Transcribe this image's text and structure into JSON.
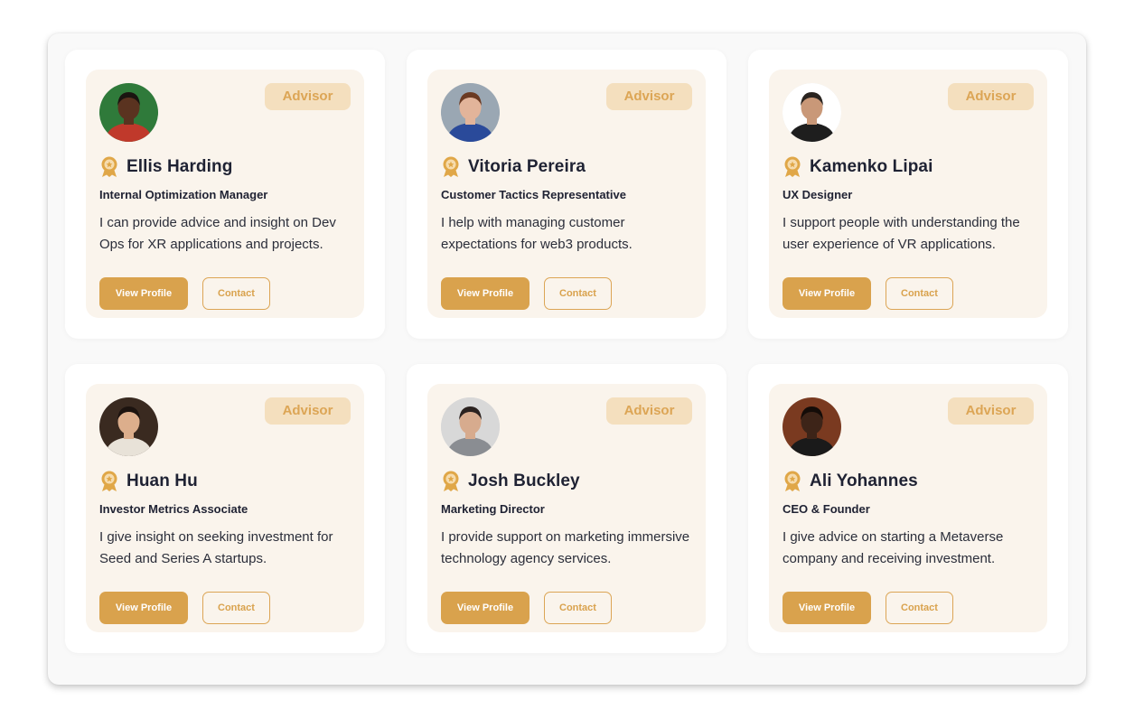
{
  "advisors": [
    {
      "badge": "Advisor",
      "name": "Ellis Harding",
      "role": "Internal Optimization Manager",
      "description": "I can provide advice and insight on Dev Ops for XR applications and projects.",
      "view_label": "View Profile",
      "contact_label": "Contact",
      "avatar": {
        "bg": "#2f7a3a",
        "skin": "#5a3320",
        "hair": "#1a1410",
        "shirt": "#c0392b"
      }
    },
    {
      "badge": "Advisor",
      "name": "Vitoria Pereira",
      "role": "Customer Tactics Representative",
      "description": "I help with managing customer expectations for web3 products.",
      "view_label": "View Profile",
      "contact_label": "Contact",
      "avatar": {
        "bg": "#9aa7b3",
        "skin": "#e2b49a",
        "hair": "#6b3a22",
        "shirt": "#2a4a9a"
      }
    },
    {
      "badge": "Advisor",
      "name": "Kamenko Lipai",
      "role": "UX Designer",
      "description": "I support people with understanding the user experience of VR applications.",
      "view_label": "View Profile",
      "contact_label": "Contact",
      "avatar": {
        "bg": "#ffffff",
        "skin": "#c99878",
        "hair": "#2a2420",
        "shirt": "#1e1e1e"
      }
    },
    {
      "badge": "Advisor",
      "name": "Huan Hu",
      "role": "Investor Metrics Associate",
      "description": "I give insight on seeking investment for Seed and Series A startups.",
      "view_label": "View Profile",
      "contact_label": "Contact",
      "avatar": {
        "bg": "#3a2a20",
        "skin": "#dcae8c",
        "hair": "#1c130f",
        "shirt": "#e8e2d8"
      }
    },
    {
      "badge": "Advisor",
      "name": "Josh Buckley",
      "role": "Marketing Director",
      "description": "I provide support on marketing immersive technology agency services.",
      "view_label": "View Profile",
      "contact_label": "Contact",
      "avatar": {
        "bg": "#d8d8d8",
        "skin": "#d7ab8e",
        "hair": "#2b2220",
        "shirt": "#8a8d92"
      }
    },
    {
      "badge": "Advisor",
      "name": "Ali Yohannes",
      "role": "CEO & Founder",
      "description": "I give advice on starting a Metaverse company and receiving investment.",
      "view_label": "View Profile",
      "contact_label": "Contact",
      "avatar": {
        "bg": "#7a3a20",
        "skin": "#3d2418",
        "hair": "#140c08",
        "shirt": "#1a1a1a"
      }
    }
  ],
  "colors": {
    "accent": "#d9a24d",
    "badge_bg": "#f4dfbe",
    "card_bg": "#faf4ec",
    "text": "#1f2233"
  },
  "icons": {
    "medal": "medal-icon"
  }
}
